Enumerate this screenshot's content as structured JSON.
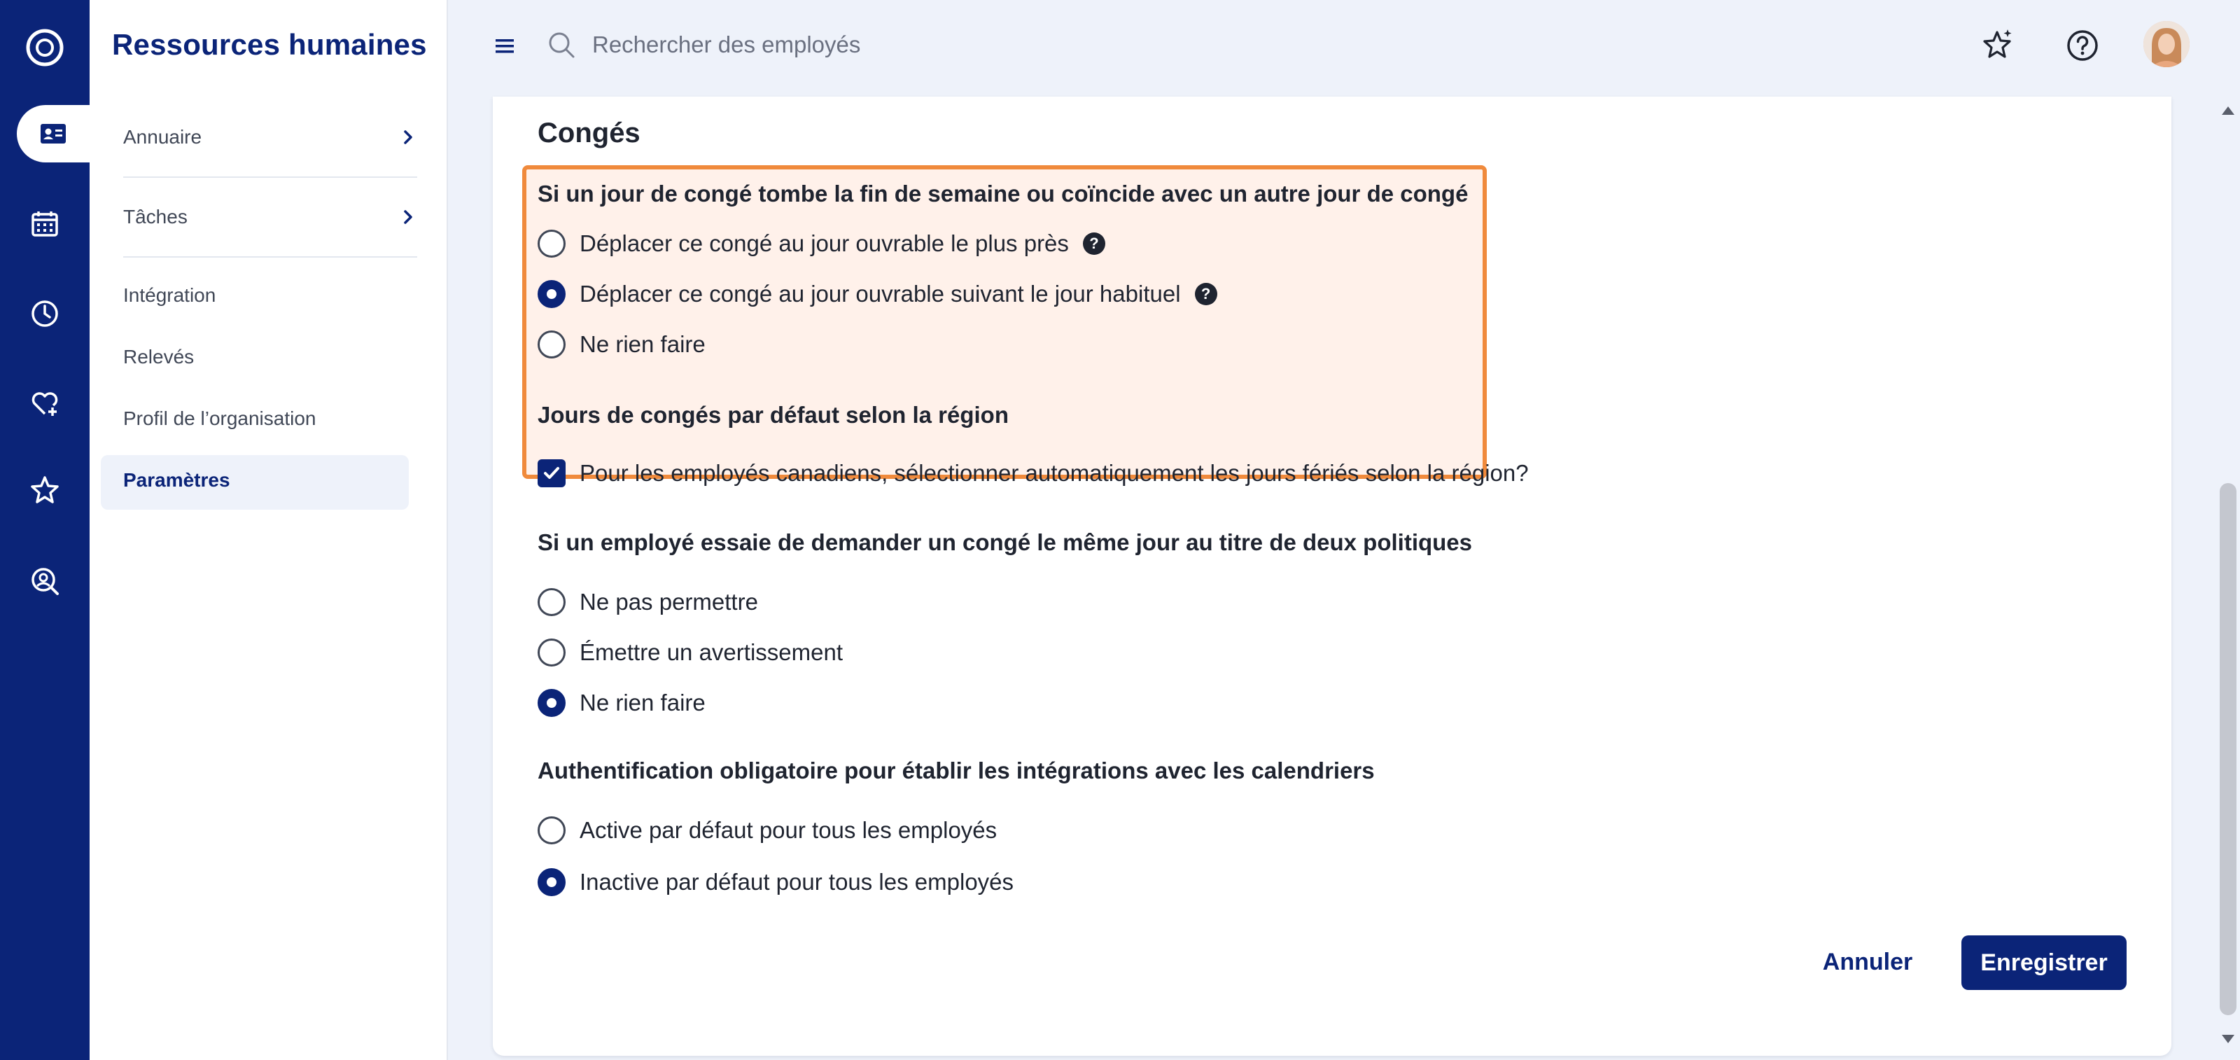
{
  "app": {
    "title": "Ressources humaines"
  },
  "rail": {
    "icons": [
      "app-logo-icon",
      "directory-card-icon",
      "calendar-icon",
      "clock-icon",
      "heart-plus-icon",
      "star-icon",
      "search-person-icon"
    ]
  },
  "subnav": {
    "items": [
      {
        "label": "Annuaire",
        "chevron": true
      },
      {
        "label": "Tâches",
        "chevron": true
      },
      {
        "label": "Intégration"
      },
      {
        "label": "Relevés"
      },
      {
        "label": "Profil de l’organisation"
      },
      {
        "label": "Paramètres",
        "active": true
      }
    ]
  },
  "topbar": {
    "search_placeholder": "Rechercher des employés",
    "icons": [
      "menu-icon",
      "search-icon",
      "star-sparkle-icon",
      "help-icon",
      "avatar"
    ]
  },
  "main": {
    "section_title": "Congés",
    "q1": {
      "title": "Si un jour de congé tombe la fin de semaine ou coïncide avec un autre jour de congé",
      "options": [
        {
          "label": "Déplacer ce congé au jour ouvrable le plus près",
          "help": "?",
          "checked": false
        },
        {
          "label": "Déplacer ce congé au jour ouvrable suivant le jour habituel",
          "help": "?",
          "checked": true
        },
        {
          "label": "Ne rien faire",
          "checked": false
        }
      ]
    },
    "q2": {
      "title": "Jours de congés par défaut selon la région",
      "checkbox_label": "Pour les employés canadiens, sélectionner automatiquement les jours fériés selon la région?",
      "checked": true
    },
    "q3": {
      "title": "Si un employé essaie de demander un congé le même jour au titre de deux politiques",
      "options": [
        {
          "label": "Ne pas permettre",
          "checked": false
        },
        {
          "label": "Émettre un avertissement",
          "checked": false
        },
        {
          "label": "Ne rien faire",
          "checked": true
        }
      ]
    },
    "q4": {
      "title": "Authentification obligatoire pour établir les intégrations avec les calendriers",
      "options": [
        {
          "label": "Active par défaut pour tous les employés",
          "checked": false
        },
        {
          "label": "Inactive par défaut pour tous les employés",
          "checked": true
        }
      ]
    },
    "buttons": {
      "cancel": "Annuler",
      "save": "Enregistrer"
    }
  },
  "colors": {
    "brand": "#0b2478",
    "highlight_border": "#f08a3c",
    "highlight_bg": "#fff1ea",
    "page_bg": "#eef2fa"
  }
}
